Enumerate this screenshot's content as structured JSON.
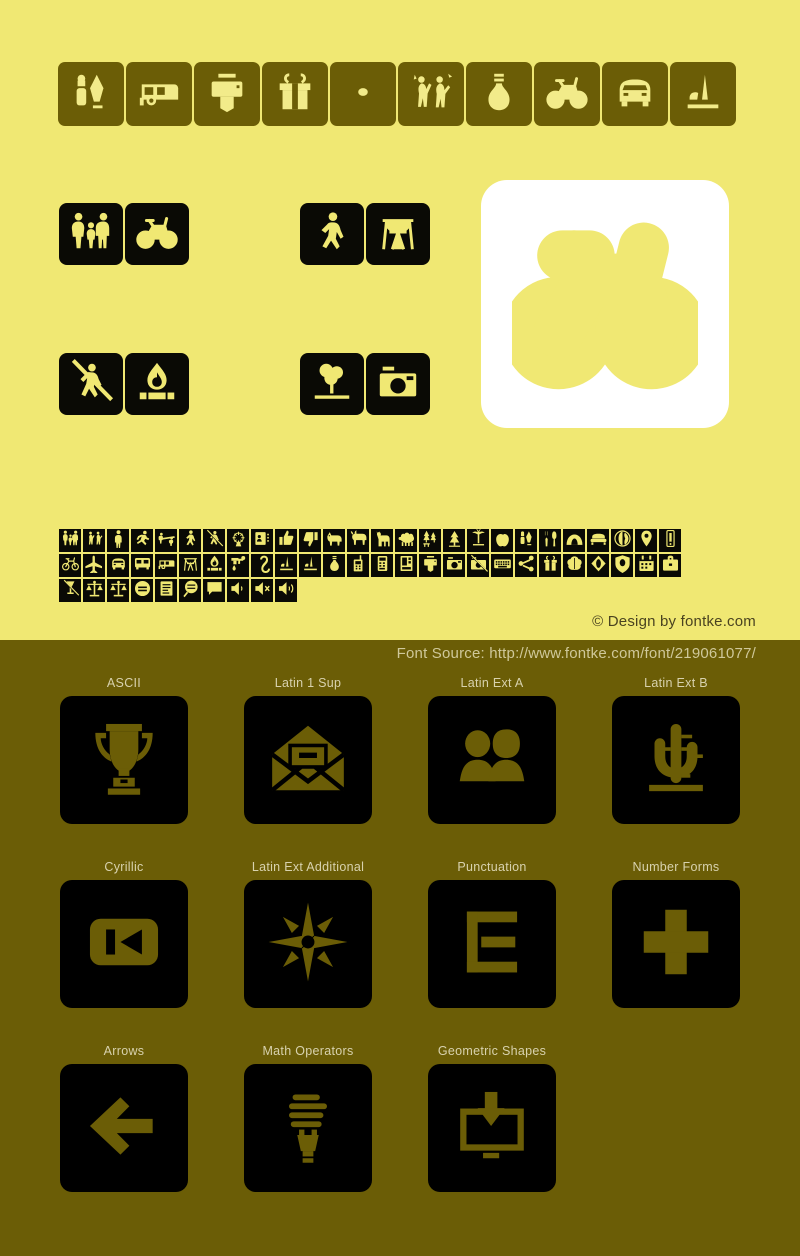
{
  "colors": {
    "background_yellow": "#F0E873",
    "background_olive": "#6B5D06",
    "tile_black": "#000000",
    "card_white": "#FFFFFF",
    "glyph_yellow": "#F0E873",
    "glyph_olive": "#6B5D06"
  },
  "credit": {
    "design": "© Design by fontke.com",
    "source": "Font Source: http://www.fontke.com/font/219061077/"
  },
  "top_strip": {
    "tiles": [
      {
        "icon": "cosmetics-icon"
      },
      {
        "icon": "caravan-trailer-icon"
      },
      {
        "icon": "printer-icon"
      },
      {
        "icon": "gift-icon"
      },
      {
        "icon": "dot-icon"
      },
      {
        "icon": "dancing-people-icon"
      },
      {
        "icon": "light-bulb-icon"
      },
      {
        "icon": "bicycle-icon"
      },
      {
        "icon": "car-icon"
      },
      {
        "icon": "monument-icon"
      }
    ]
  },
  "tile_groups": [
    {
      "name": "group-family-bicycle",
      "tiles": [
        {
          "icon": "family-icon"
        },
        {
          "icon": "bicycle-icon"
        }
      ]
    },
    {
      "name": "group-walking-bridge",
      "tiles": [
        {
          "icon": "walking-person-icon"
        },
        {
          "icon": "viaduct-bridge-icon"
        }
      ]
    },
    {
      "name": "group-no-walking-campfire",
      "tiles": [
        {
          "icon": "no-walking-icon"
        },
        {
          "icon": "campfire-icon"
        }
      ]
    },
    {
      "name": "group-park-camera",
      "tiles": [
        {
          "icon": "park-tree-icon"
        },
        {
          "icon": "camera-icon"
        }
      ]
    }
  ],
  "big_card": {
    "icon": "bicycle-outline-icon"
  },
  "glyph_matrix": {
    "rows": [
      [
        "family-icon",
        "dancing-people-icon",
        "standing-person-icon",
        "running-person-icon",
        "seesaw-icon",
        "walking-person-icon",
        "no-walking-icon",
        "fireworks-icon",
        "id-card-icon",
        "thumbs-up-icon",
        "thumbs-down-icon",
        "dog-icon",
        "goat-icon",
        "llama-icon",
        "sheep-icon",
        "forest-picnic-icon",
        "tree-icon",
        "palm-tree-icon",
        "apple-icon",
        "cosmetics-icon",
        "cutlery-icon",
        "cave-icon",
        "bed-icon",
        "globe-icon",
        "map-pin-icon",
        "mobile-phone-icon"
      ],
      [
        "bicycle-icon",
        "airplane-icon",
        "car-icon",
        "bus-icon",
        "caravan-trailer-icon",
        "viaduct-bridge-icon",
        "campfire-icon",
        "tap-water-icon",
        "hook-icon",
        "monument-icon",
        "monument-icon",
        "light-bulb-icon",
        "walkie-talkie-icon",
        "calculator-icon",
        "vending-machine-icon",
        "printer-icon",
        "camera-icon",
        "no-photo-icon",
        "keyboard-icon",
        "share-icon",
        "gift-icon",
        "brain-icon",
        "diamond-icon",
        "shield-icon",
        "calendar-icon",
        "briefcase-icon"
      ],
      [
        "no-drinking-icon",
        "scales-icon",
        "scales-icon",
        "equals-circle-icon",
        "document-icon",
        "search-chat-icon",
        "chat-bubble-icon",
        "speaker-low-icon",
        "speaker-mute-icon",
        "speaker-high-icon"
      ]
    ]
  },
  "showcase": {
    "rows": [
      {
        "cells": [
          {
            "label": "ASCII",
            "icon": "trophy-icon"
          },
          {
            "label": "Latin 1 Sup",
            "icon": "open-envelope-icon"
          },
          {
            "label": "Latin Ext A",
            "icon": "two-people-icon"
          },
          {
            "label": "Latin Ext B",
            "icon": "cactus-icon"
          }
        ]
      },
      {
        "cells": [
          {
            "label": "Cyrillic",
            "icon": "skip-previous-icon"
          },
          {
            "label": "Latin Ext Additional",
            "icon": "compass-rose-icon"
          },
          {
            "label": "Punctuation",
            "icon": "letter-e-icon"
          },
          {
            "label": "Number Forms",
            "icon": "plus-icon"
          }
        ]
      },
      {
        "cells": [
          {
            "label": "Arrows",
            "icon": "arrow-left-icon"
          },
          {
            "label": "Math Operators",
            "icon": "cfl-bulb-icon"
          },
          {
            "label": "Geometric Shapes",
            "icon": "download-monitor-icon"
          }
        ]
      }
    ]
  }
}
